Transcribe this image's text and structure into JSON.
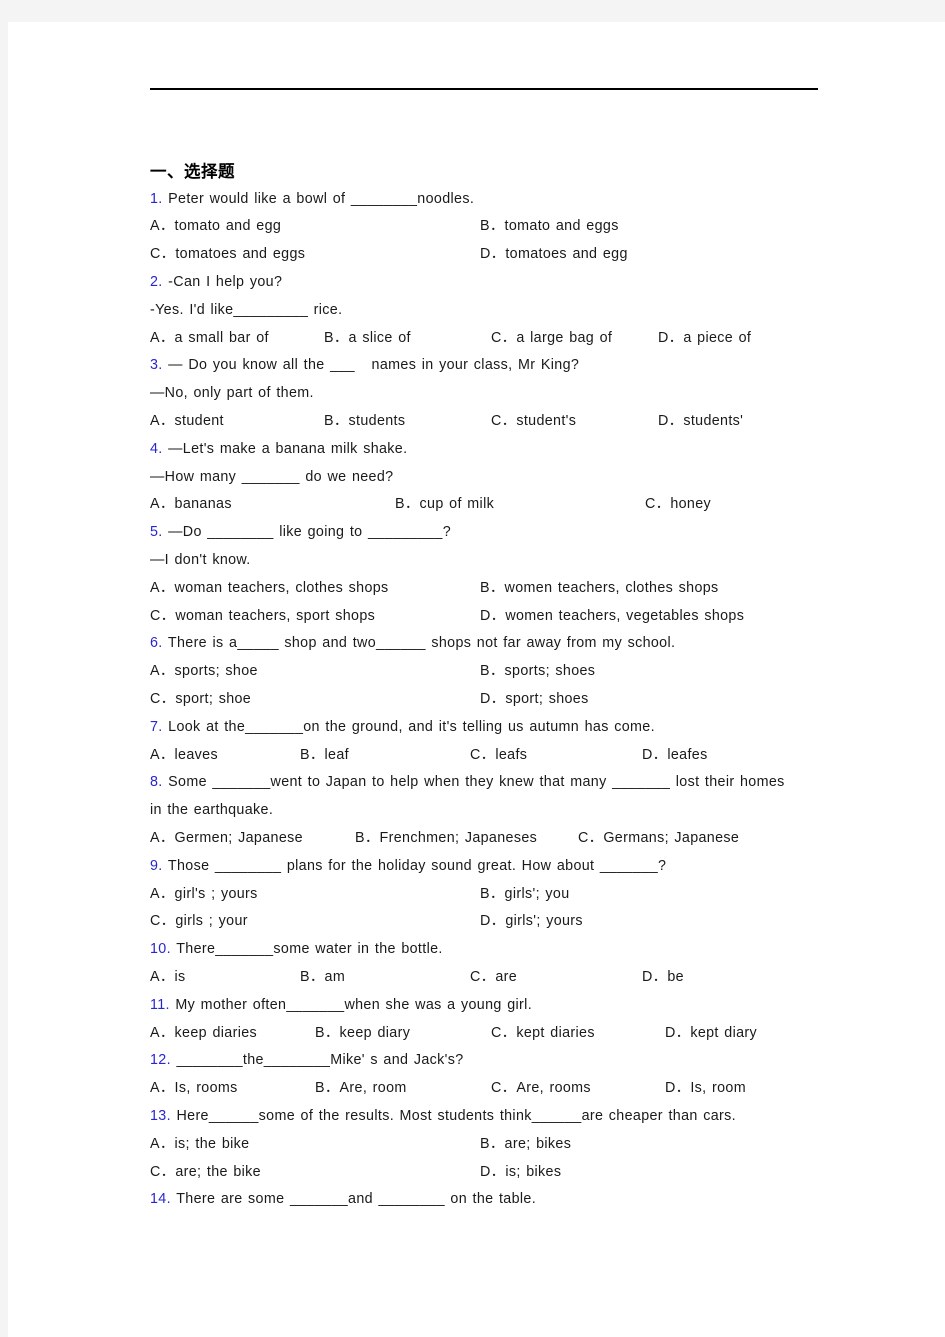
{
  "page": {
    "background_color": "#f4f4f4",
    "paper_color": "#ffffff",
    "number_color": "#2a25cf",
    "text_color": "#1a1a1a"
  },
  "section": {
    "heading": "一、选择题"
  },
  "questions": [
    {
      "num": "1.",
      "lines": [
        "Peter would like a bowl of ________noodles."
      ],
      "layout": "cols-2",
      "options": [
        "A．tomato and egg",
        "B．tomato and eggs",
        "C．tomatoes and eggs",
        "D．tomatoes and egg"
      ]
    },
    {
      "num": "2.",
      "lines": [
        "-Can I help you?",
        "-Yes. I'd like_________ rice."
      ],
      "layout": "cols-4",
      "options": [
        "A．a small bar of",
        "B．a slice of",
        "C．a large bag of",
        "D．a piece of"
      ]
    },
    {
      "num": "3.",
      "lines": [
        "— Do you know all the ___   names in your class, Mr King?",
        "—No, only part of them."
      ],
      "layout": "cols-4",
      "options": [
        "A．student",
        "B．students",
        "C．student's",
        "D．students'"
      ]
    },
    {
      "num": "4.",
      "lines": [
        "—Let's make a banana milk shake.",
        "—How many _______ do we need?"
      ],
      "layout": "cols-3",
      "options": [
        "A．bananas",
        "B．cup of milk",
        "C．honey"
      ]
    },
    {
      "num": "5.",
      "lines": [
        "—Do ________ like going to _________?",
        "—I don't know."
      ],
      "layout": "cols-2",
      "options": [
        "A．woman teachers, clothes shops",
        "B．women teachers, clothes shops",
        "C．woman teachers, sport shops",
        "D．women teachers, vegetables shops"
      ]
    },
    {
      "num": "6.",
      "lines": [
        "There is a_____ shop and two______ shops not far away from my school."
      ],
      "layout": "cols-2",
      "options": [
        "A．sports; shoe",
        "B．sports; shoes",
        "C．sport; shoe",
        "D．sport; shoes"
      ]
    },
    {
      "num": "7.",
      "lines": [
        "Look at the_______on the ground, and it's telling us autumn has come."
      ],
      "layout": "cols-4w",
      "options": [
        "A．leaves",
        "B．leaf",
        "C．leafs",
        "D．leafes"
      ]
    },
    {
      "num": "8.",
      "lines": [
        "Some _______went to Japan to help when they knew that many _______ lost their homes",
        "in the earthquake."
      ],
      "layout": "cols-3b",
      "options": [
        "A．Germen; Japanese",
        "B．Frenchmen; Japaneses",
        "C．Germans; Japanese"
      ]
    },
    {
      "num": "9.",
      "lines": [
        "Those ________ plans for the holiday sound great. How about _______?"
      ],
      "layout": "cols-2",
      "options": [
        "A．girl's ; yours",
        "B．girls'; you",
        "C．girls ; your",
        "D．girls'; yours"
      ]
    },
    {
      "num": "10.",
      "lines": [
        "There_______some water in the bottle."
      ],
      "layout": "cols-4w",
      "options": [
        "A．is",
        "B．am",
        "C．are",
        "D．be"
      ]
    },
    {
      "num": "11.",
      "lines": [
        "My mother often_______when she was a young girl."
      ],
      "layout": "cols-4n",
      "options": [
        "A．keep diaries",
        "B．keep diary",
        "C．kept diaries",
        "D．kept diary"
      ]
    },
    {
      "num": "12.",
      "lines": [
        "________the________Mike' s and Jack's?"
      ],
      "layout": "cols-4n",
      "options": [
        "A．Is, rooms",
        "B．Are, room",
        "C．Are, rooms",
        "D．Is, room"
      ]
    },
    {
      "num": "13.",
      "lines": [
        "Here______some of the results. Most students think______are cheaper than cars."
      ],
      "layout": "cols-2",
      "options": [
        "A．is; the bike",
        "B．are; bikes",
        "C．are; the bike",
        "D．is; bikes"
      ]
    },
    {
      "num": "14.",
      "lines": [
        "There are some _______and ________ on the table."
      ],
      "layout": "cols-2",
      "options": []
    }
  ]
}
